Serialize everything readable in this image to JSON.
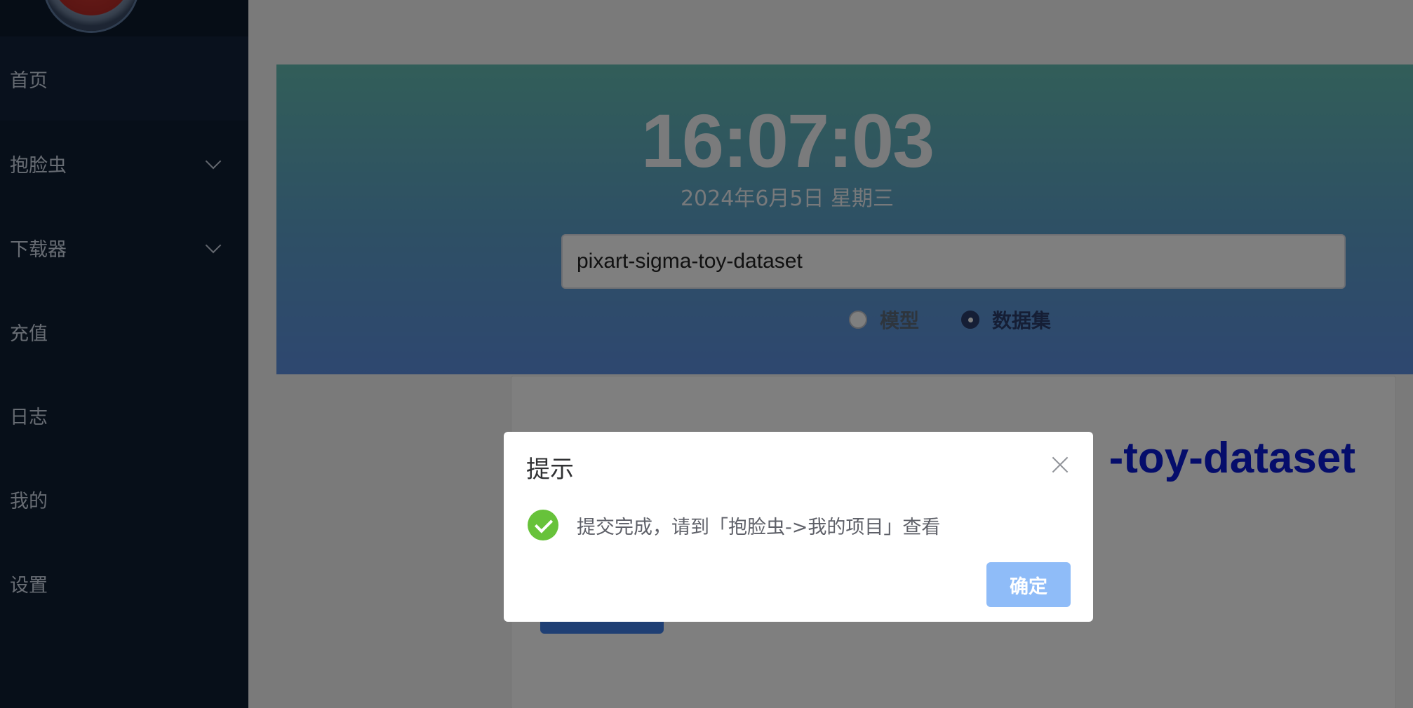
{
  "sidebar": {
    "items": [
      {
        "label": "首页"
      },
      {
        "label": "抱脸虫"
      },
      {
        "label": "下载器"
      },
      {
        "label": "充值"
      },
      {
        "label": "日志"
      },
      {
        "label": "我的"
      },
      {
        "label": "设置"
      }
    ]
  },
  "header": {
    "clock": "16:07:03",
    "date": "2024年6月5日 星期三"
  },
  "search": {
    "value": "pixart-sigma-toy-dataset"
  },
  "type_selector": {
    "options": [
      {
        "label": "模型",
        "checked": false
      },
      {
        "label": "数据集",
        "checked": true
      }
    ]
  },
  "card": {
    "title_visible": "-toy-dataset"
  },
  "dialog": {
    "title": "提示",
    "message": "提交完成，请到「抱脸虫->我的项目」查看",
    "confirm_label": "确定",
    "icon": "success-check-icon",
    "close_icon": "close-icon"
  },
  "colors": {
    "sidebar_bg": "#0f1e33",
    "hero_gradient_top": "#64bcb2",
    "hero_gradient_bottom": "#5c8fe0",
    "success": "#67c23a",
    "primary_button": "#8fbcf8",
    "card_title": "#0b1bd6"
  }
}
